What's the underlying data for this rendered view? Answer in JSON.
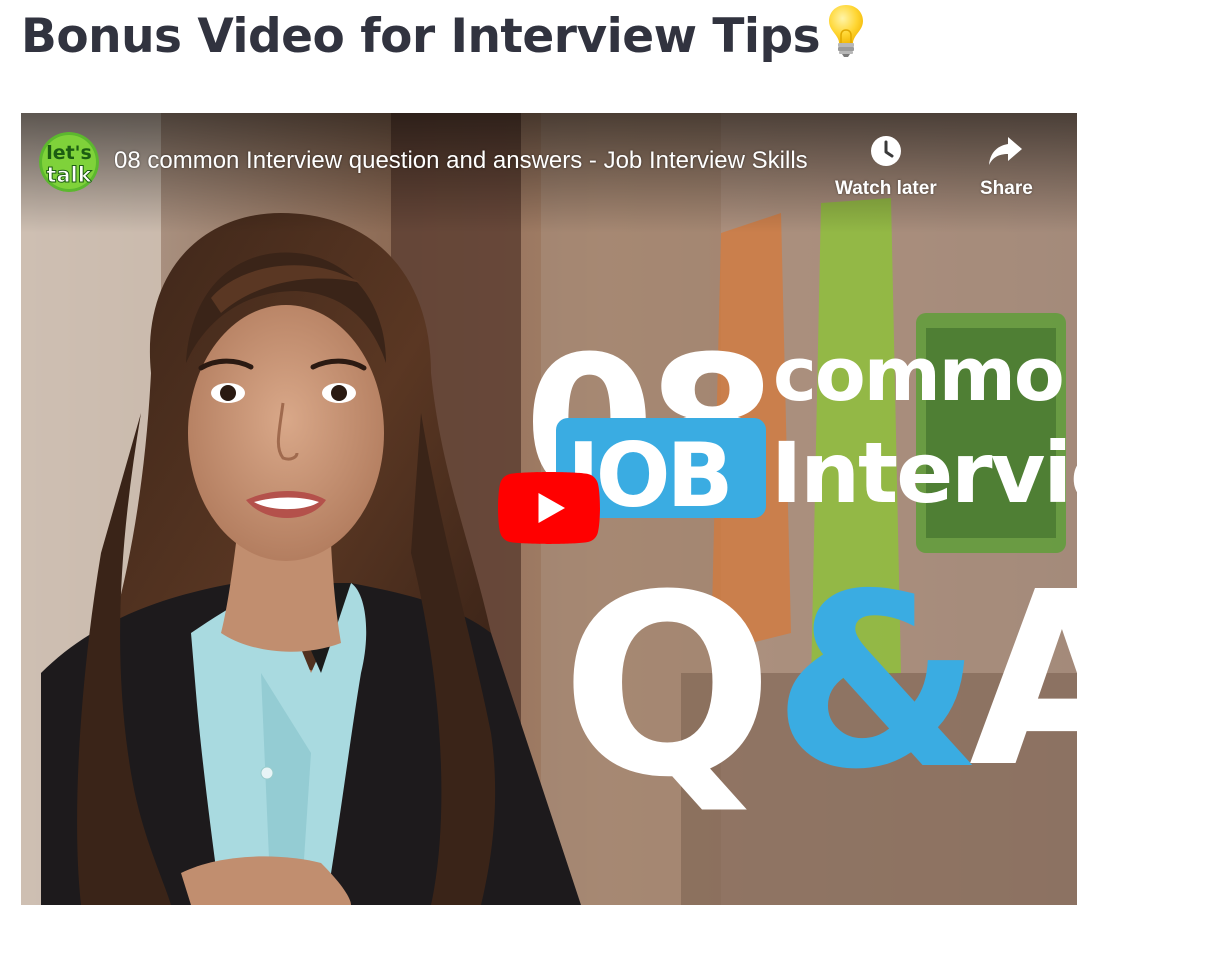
{
  "page": {
    "heading": "Bonus Video for Interview Tips",
    "heading_emoji": "lightbulb-icon"
  },
  "video": {
    "title": "08 common Interview question and answers - Job Interview Skills",
    "channel_logo_text": [
      "let's",
      "talk"
    ],
    "thumbnail_text": {
      "number": "08",
      "word_common": "commo",
      "badge": "JOB",
      "word_interview": "Intervie",
      "q": "Q",
      "amp": "&",
      "a": "A"
    },
    "actions": {
      "watch_later": "Watch later",
      "share": "Share"
    },
    "icons": {
      "watch_later": "clock-icon",
      "share": "share-arrow-icon",
      "play": "play-icon"
    },
    "colors": {
      "play_button": "#ff0000",
      "badge_blue": "#3aace2",
      "heading": "#31333f"
    }
  }
}
